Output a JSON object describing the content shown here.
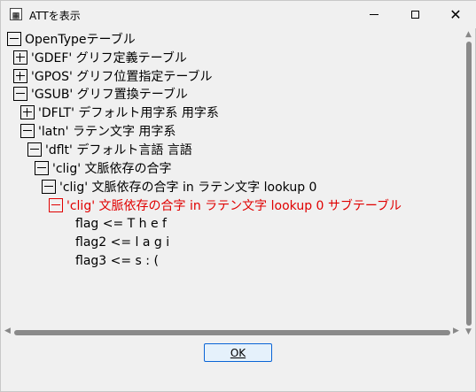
{
  "window": {
    "title": "ATTを表示",
    "app_icon": "app-icon",
    "controls": {
      "minimize_icon": "minimize-icon",
      "maximize_icon": "maximize-icon",
      "close_icon": "close-icon",
      "close_glyph": "✕"
    }
  },
  "tree": {
    "nodes": [
      {
        "label": "OpenTypeテーブル",
        "state": "expanded"
      },
      {
        "label": "'GDEF' グリフ定義テーブル",
        "state": "collapsed"
      },
      {
        "label": "'GPOS' グリフ位置指定テーブル",
        "state": "collapsed"
      },
      {
        "label": "'GSUB' グリフ置換テーブル",
        "state": "expanded"
      },
      {
        "label": "'DFLT' デフォルト用字系 用字系",
        "state": "collapsed"
      },
      {
        "label": "'latn' ラテン文字 用字系",
        "state": "expanded"
      },
      {
        "label": "'dflt' デフォルト言語 言語",
        "state": "expanded"
      },
      {
        "label": "'clig' 文脈依存の合字",
        "state": "expanded"
      },
      {
        "label": "'clig' 文脈依存の合字 in ラテン文字 lookup 0",
        "state": "expanded"
      },
      {
        "label": "'clig' 文脈依存の合字 in ラテン文字 lookup 0 サブテーブル",
        "state": "expanded",
        "selected": true
      }
    ],
    "leaves": [
      "flag <= T h e f",
      "flag2 <= l a g i",
      "flag3 <= s : ("
    ],
    "selected_color": "#e00000"
  },
  "buttons": {
    "ok": "OK"
  }
}
